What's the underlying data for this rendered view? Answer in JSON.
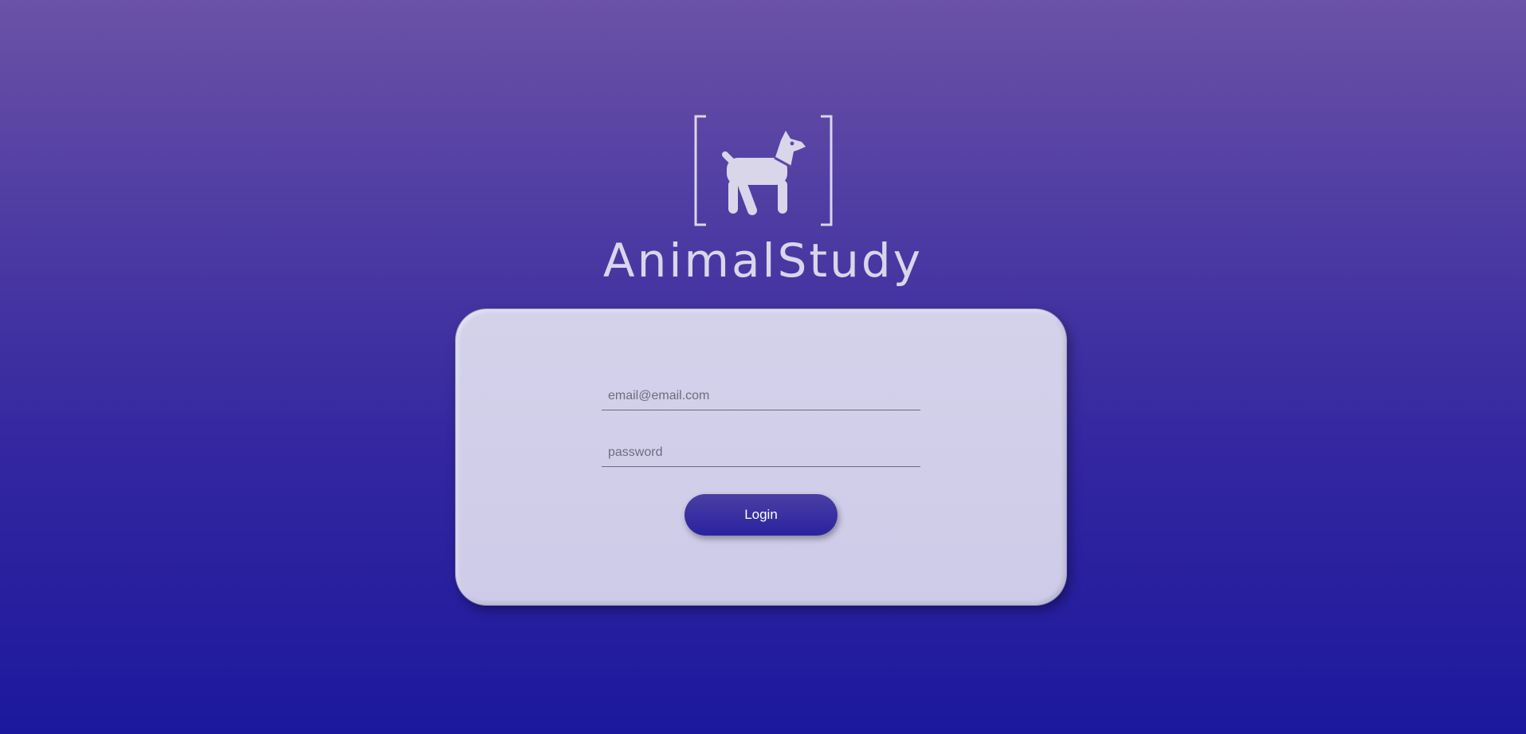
{
  "brand": {
    "name": "AnimalStudy",
    "logo_icon": "dog-icon"
  },
  "login_form": {
    "email_placeholder": "email@email.com",
    "email_value": "",
    "password_placeholder": "password",
    "password_value": "",
    "login_label": "Login"
  },
  "colors": {
    "background_top": "#6b52a6",
    "background_bottom": "#1c189d",
    "card": "#d2d0e9",
    "button": "#3a30a2",
    "logo": "#d9d6ea"
  }
}
